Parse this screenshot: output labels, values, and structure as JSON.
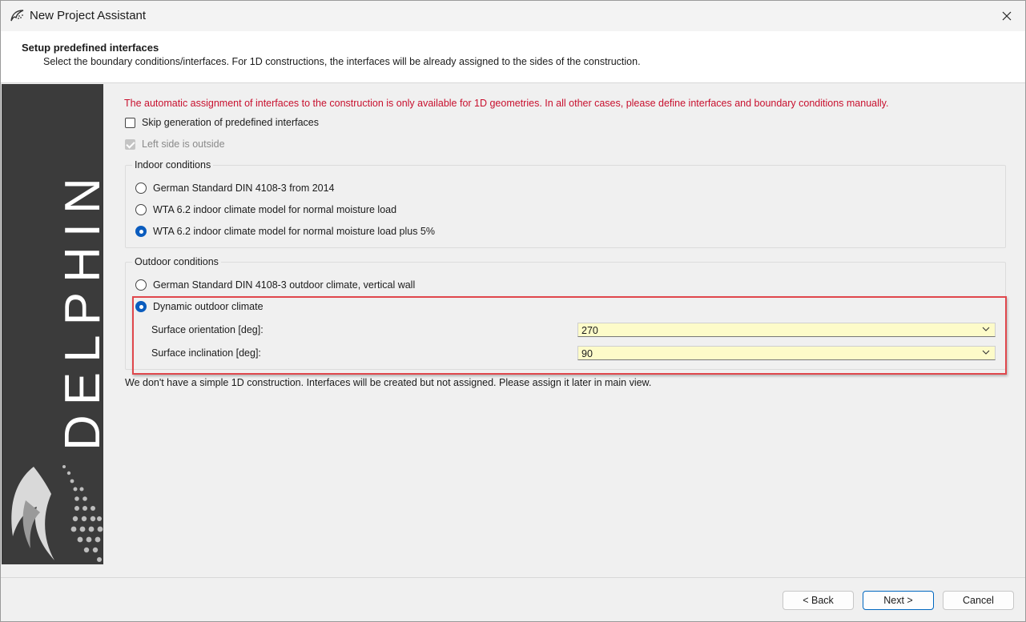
{
  "window": {
    "title": "New Project Assistant"
  },
  "header": {
    "title": "Setup predefined interfaces",
    "subtitle": "Select the boundary conditions/interfaces. For 1D constructions, the interfaces will be already assigned to the sides of the construction."
  },
  "banner": {
    "brand_text": "DELPHIN"
  },
  "content": {
    "warning": "The automatic assignment of interfaces to the construction is only available for 1D geometries. In all other cases, please define interfaces and boundary conditions manually.",
    "skip_checkbox": {
      "label": "Skip generation of predefined interfaces",
      "checked": false
    },
    "left_side_checkbox": {
      "label": "Left side is outside",
      "checked": true,
      "enabled": false
    },
    "indoor": {
      "title": "Indoor conditions",
      "options": [
        {
          "label": "German Standard DIN 4108-3 from 2014",
          "selected": false
        },
        {
          "label": "WTA 6.2 indoor climate model for normal moisture load",
          "selected": false
        },
        {
          "label": "WTA 6.2 indoor climate model for normal moisture load plus 5%",
          "selected": true
        }
      ]
    },
    "outdoor": {
      "title": "Outdoor conditions",
      "options": [
        {
          "label": "German Standard DIN 4108-3 outdoor climate, vertical wall",
          "selected": false
        },
        {
          "label": "Dynamic outdoor climate",
          "selected": true
        }
      ],
      "orientation": {
        "label": "Surface orientation [deg]:",
        "value": "270"
      },
      "inclination": {
        "label": "Surface inclination [deg]:",
        "value": "90"
      }
    },
    "note": "We don't have a simple 1D construction. Interfaces will be created but not assigned. Please assign it later in main view."
  },
  "footer": {
    "back_label": "< Back",
    "next_label": "Next >",
    "cancel_label": "Cancel"
  },
  "colors": {
    "warning": "#c8102e",
    "accent": "#0b5cbe",
    "combo_bg": "#fdfbc9",
    "highlight": "#e0474c"
  }
}
